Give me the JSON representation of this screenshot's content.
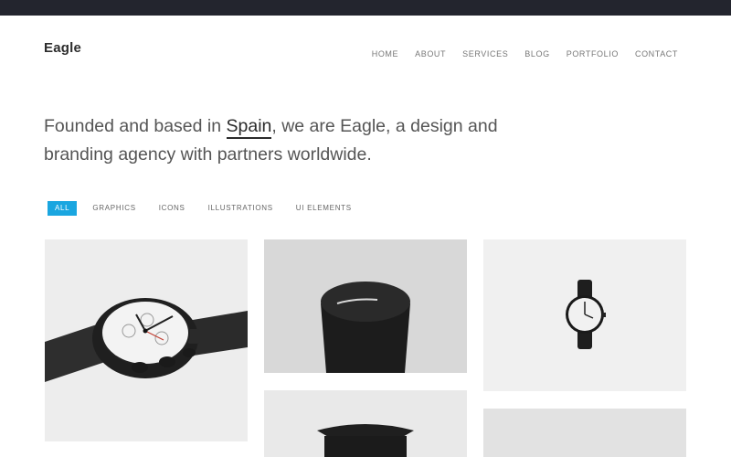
{
  "header": {
    "brand": "Eagle",
    "nav": [
      "HOME",
      "ABOUT",
      "SERVICES",
      "BLOG",
      "PORTFOLIO",
      "CONTACT"
    ]
  },
  "hero": {
    "before": "Founded and based in ",
    "highlight": "Spain",
    "after": ", we are Eagle, a design and branding agency with partners worldwide."
  },
  "filters": {
    "active": "ALL",
    "items": [
      "GRAPHICS",
      "ICONS",
      "ILLUSTRATIONS",
      "UI ELEMENTS"
    ]
  },
  "colors": {
    "topbar": "#23252e",
    "accent": "#1aa6e0"
  },
  "portfolio": {
    "items": [
      "chronograph-watch",
      "black-speaker-cap",
      "minimal-wristwatch",
      "black-lamp-base",
      "gray-tile"
    ]
  }
}
